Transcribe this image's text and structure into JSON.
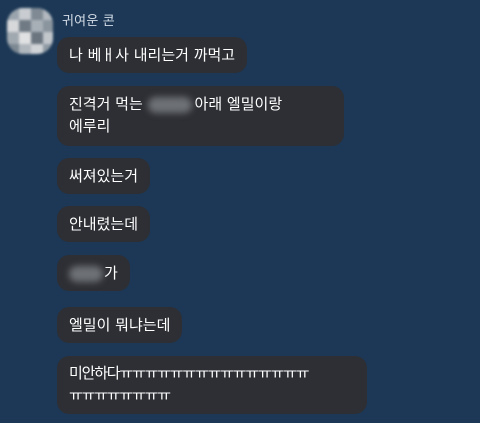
{
  "chat": {
    "sender_name": "귀여운 콘",
    "messages": [
      {
        "text": "나 베ㅐ사 내리는거 까먹고"
      },
      {
        "line1_before": "진격거 먹는 ",
        "line1_after": "아래 엘밀이랑",
        "line2": "에루리"
      },
      {
        "text": "써져있는거"
      },
      {
        "text": "안내렸는데"
      },
      {
        "after": "가"
      },
      {
        "text": "엘밀이 뭐냐는데"
      },
      {
        "line1": "미안하다ㅠㅠㅠㅠㅠㅠㅠㅠㅠㅠㅠㅠㅠㅠㅠ",
        "line2": "ㅠㅠㅠㅠㅠㅠㅠㅠ"
      }
    ]
  },
  "colors": {
    "background": "#1c3856",
    "bubble": "#2d2f34",
    "text": "#ffffff",
    "sender": "#d4dce6"
  }
}
